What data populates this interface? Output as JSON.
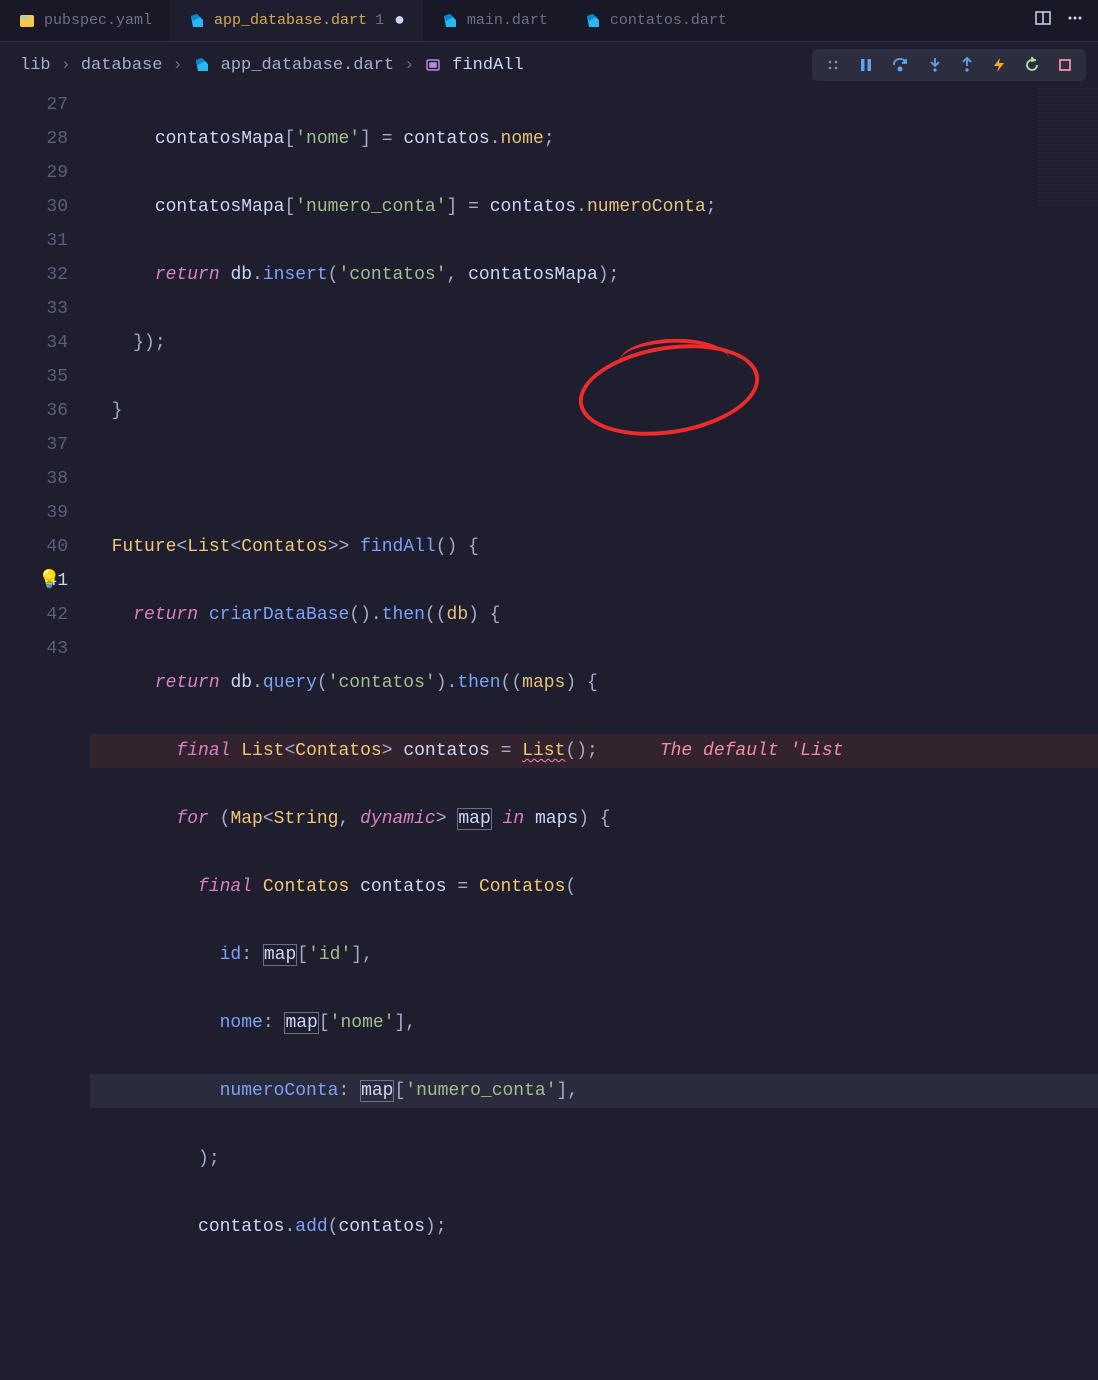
{
  "tabs": [
    {
      "name": "pubspec.yaml",
      "icon": "yaml"
    },
    {
      "name": "app_database.dart",
      "icon": "dart",
      "modified": "1",
      "active": true,
      "dirty": "●"
    },
    {
      "name": "main.dart",
      "icon": "dart"
    },
    {
      "name": "contatos.dart",
      "icon": "dart"
    }
  ],
  "breadcrumb": {
    "p0": "lib",
    "p1": "database",
    "p2": "app_database.dart",
    "p3": "findAll"
  },
  "gutter": [
    "27",
    "28",
    "29",
    "30",
    "31",
    "32",
    "33",
    "34",
    "35",
    "36",
    "37",
    "38",
    "39",
    "40",
    "41",
    "42",
    "43"
  ],
  "tokens": {
    "contatosMapa": "contatosMapa",
    "nome_key": "'nome'",
    "numero_conta_key": "'numero_conta'",
    "id_key": "'id'",
    "contatos_str": "'contatos'",
    "contatos": "contatos",
    "nome": "nome",
    "numeroConta": "numeroConta",
    "return": "return",
    "db": "db",
    "insert": "insert",
    "Future": "Future",
    "List": "List",
    "Contatos": "Contatos",
    "findAll": "findAll",
    "criarDataBase": "criarDataBase",
    "then": "then",
    "query": "query",
    "maps": "maps",
    "map": "map",
    "final": "final",
    "for": "for",
    "in": "in",
    "Map": "Map",
    "String": "String",
    "dynamic": "dynamic",
    "id": "id",
    "nome_named": "nome",
    "numeroConta_named": "numeroConta",
    "add": "add"
  },
  "inline_error": "The default 'List",
  "debug_icons": {
    "grip": "grip",
    "pause": "pause",
    "step_over": "step-over",
    "step_into": "step-into",
    "step_out": "step-out",
    "bolt": "bolt",
    "restart": "restart",
    "stop": "stop"
  },
  "colors": {
    "bg": "#1e1e2e",
    "keyword": "#d880c0",
    "type": "#f0c674",
    "function": "#7aa2f7",
    "string": "#a3be8c",
    "error": "#f38ba8",
    "annotation": "#ee2b2b"
  }
}
